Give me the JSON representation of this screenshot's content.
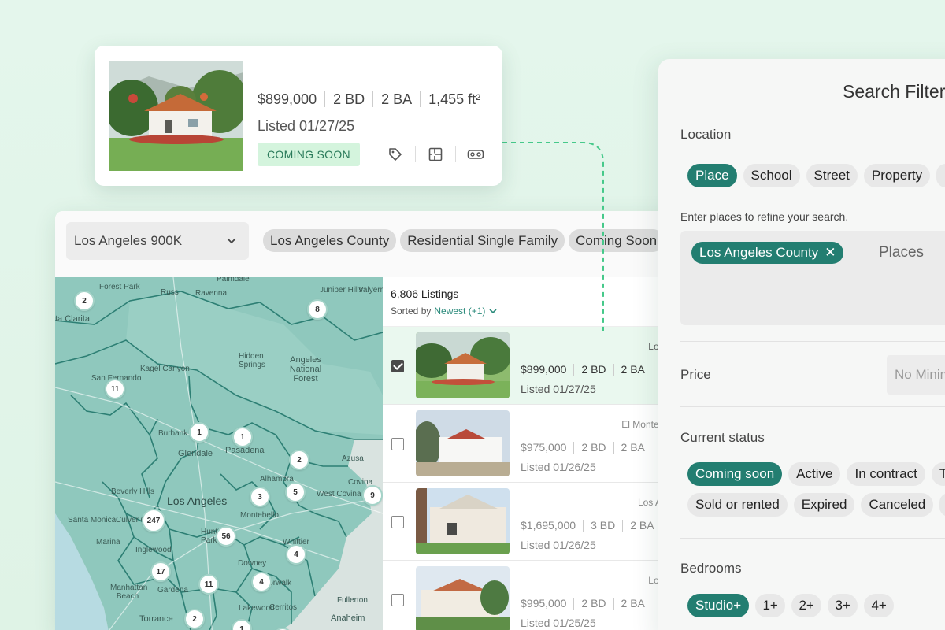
{
  "featured_card": {
    "price": "$899,000",
    "beds": "2 BD",
    "baths": "2 BA",
    "sqft": "1,455 ft²",
    "listed": "Listed 01/27/25",
    "status_badge": "COMING SOON",
    "icons": [
      "tag-icon",
      "floorplan-icon",
      "vr-tour-icon"
    ]
  },
  "search_bar": {
    "saved_search": "Los Angeles 900K",
    "chips": [
      "Los Angeles County",
      "Residential Single Family",
      "Coming Soon"
    ]
  },
  "map": {
    "labels": {
      "forest_park": "Forest Park",
      "russ": "Russ",
      "ravenna": "Ravenna",
      "juniper_hills": "Juniper Hills",
      "valyermo": "Valyermo",
      "santa_clarita": "ta Clarita",
      "hidden_springs": "Hidden Springs",
      "angeles_nf": "Angeles National Forest",
      "kagel_canyon": "Kagel Canyon",
      "san_fernando": "San Fernando",
      "burbank": "Burbank",
      "glendale": "Glendale",
      "pasadena": "Pasadena",
      "azusa": "Azusa",
      "alhambra": "Alhambra",
      "covina": "Covina",
      "west_covina": "West Covina",
      "beverly_hills": "Beverly Hills",
      "los_angeles": "Los Angeles",
      "santa_monica": "Santa Monica",
      "culver_city": "Culver Ci",
      "montebello": "Montebello",
      "huntington_park": "Huntin Park",
      "marina": "Marina",
      "inglewood": "Inglewood",
      "whittier": "Whittier",
      "downey": "Downey",
      "norwalk": "Norwalk",
      "manhattan_beach": "Manhattan Beach",
      "gardena": "Gardena",
      "lakewood": "Lakewood",
      "cerritos": "Cerritos",
      "fullerton": "Fullerton",
      "anaheim": "Anaheim",
      "torrance": "Torrance",
      "palmdale": "Palmdale"
    },
    "clusters": [
      "2",
      "8",
      "11",
      "1",
      "1",
      "2",
      "3",
      "5",
      "9",
      "247",
      "56",
      "4",
      "17",
      "11",
      "4",
      "2",
      "1",
      "1"
    ]
  },
  "listings": {
    "count": "6,806 Listings",
    "sort_label": "Sorted by",
    "sort_value": "Newest (+1)",
    "rows": [
      {
        "city": "Los An",
        "price": "$899,000",
        "beds": "2 BD",
        "baths": "2 BA",
        "listed": "Listed 01/27/25",
        "checked": true
      },
      {
        "city": "El Monte, CA",
        "price": "$975,000",
        "beds": "2 BD",
        "baths": "2 BA",
        "listed": "Listed 01/26/25",
        "checked": false
      },
      {
        "city": "Los Ange",
        "price": "$1,695,000",
        "beds": "3 BD",
        "baths": "2 BA",
        "listed": "Listed 01/26/25",
        "checked": false
      },
      {
        "city": "Los An",
        "price": "$995,000",
        "beds": "2 BD",
        "baths": "2 BA",
        "listed": "Listed 01/25/25",
        "checked": false
      }
    ]
  },
  "filters": {
    "title": "Search Filters",
    "location": {
      "label": "Location",
      "tabs": [
        "Place",
        "School",
        "Street",
        "Property",
        ""
      ],
      "help": "Enter places to refine your search.",
      "selected_place": "Los Angeles County",
      "places_placeholder": "Places"
    },
    "price": {
      "label": "Price",
      "min_placeholder": "No Minim"
    },
    "status": {
      "label": "Current status",
      "row1": [
        "Coming soon",
        "Active",
        "In contract",
        "T"
      ],
      "row2": [
        "Sold or rented",
        "Expired",
        "Canceled",
        ""
      ]
    },
    "bedrooms": {
      "label": "Bedrooms",
      "options": [
        "Studio+",
        "1+",
        "2+",
        "3+",
        "4+"
      ]
    }
  },
  "colors": {
    "accent": "#237e71",
    "badge_bg": "#d4f4dd",
    "map_fill": "#8fc8bd",
    "background": "#e4f6ec"
  }
}
